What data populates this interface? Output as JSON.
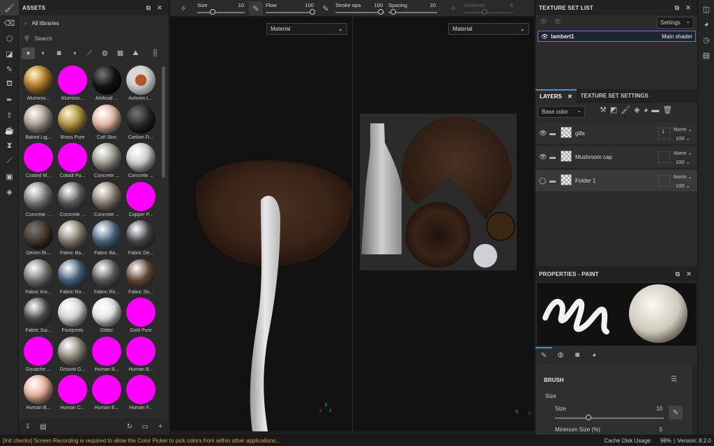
{
  "assets": {
    "title": "ASSETS",
    "all_libraries": "All libraries",
    "search_placeholder": "Search",
    "tiles": [
      {
        "label": "Aluminiu...",
        "color": "#b8862e",
        "style": "gold-dots"
      },
      {
        "label": "Aluminiu...",
        "color": "#ff00ff",
        "style": "flat"
      },
      {
        "label": "Artificial ...",
        "color": "#151515",
        "style": "dark"
      },
      {
        "label": "Autumn L...",
        "color": "#d8d8d8",
        "style": "leaf"
      },
      {
        "label": "Baked Lig...",
        "color": "#a8998a",
        "style": "flat"
      },
      {
        "label": "Brass Pure",
        "color": "#b89a4a",
        "style": "metal"
      },
      {
        "label": "Calf Skin",
        "color": "#e4b8a2",
        "style": "flat"
      },
      {
        "label": "Carbon Fi...",
        "color": "#2a2a2a",
        "style": "dark"
      },
      {
        "label": "Coated M...",
        "color": "#ff00ff",
        "style": "flat"
      },
      {
        "label": "Cobalt Pu...",
        "color": "#ff00ff",
        "style": "flat"
      },
      {
        "label": "Concrete ...",
        "color": "#9c9890",
        "style": "flat"
      },
      {
        "label": "Concrete ...",
        "color": "#cfcfcf",
        "style": "flat"
      },
      {
        "label": "Concrete ...",
        "color": "#7e7e7e",
        "style": "flat"
      },
      {
        "label": "Concrete ...",
        "color": "#5e5e5e",
        "style": "flat"
      },
      {
        "label": "Concrete ...",
        "color": "#8e8272",
        "style": "flat"
      },
      {
        "label": "Copper P...",
        "color": "#ff00ff",
        "style": "flat"
      },
      {
        "label": "Denim Ri...",
        "color": "#4a3a30",
        "style": "dark"
      },
      {
        "label": "Fabric Ba...",
        "color": "#8a8270",
        "style": "flat"
      },
      {
        "label": "Fabric Ba...",
        "color": "#4c6a82",
        "style": "flat"
      },
      {
        "label": "Fabric De...",
        "color": "#474a4e",
        "style": "flat"
      },
      {
        "label": "Fabric Kni...",
        "color": "#7a7a7a",
        "style": "flat"
      },
      {
        "label": "Fabric Ro...",
        "color": "#4a6480",
        "style": "flat"
      },
      {
        "label": "Fabric Ro...",
        "color": "#5e5e60",
        "style": "flat"
      },
      {
        "label": "Fabric So...",
        "color": "#6a4c3a",
        "style": "flat"
      },
      {
        "label": "Fabric Sui...",
        "color": "#4e4e4e",
        "style": "flat"
      },
      {
        "label": "Footprints",
        "color": "#d8d8d8",
        "style": "flat"
      },
      {
        "label": "Glitter",
        "color": "#e8e8e8",
        "style": "flat"
      },
      {
        "label": "Gold Pure",
        "color": "#ff00ff",
        "style": "flat"
      },
      {
        "label": "Gouache ...",
        "color": "#ff00ff",
        "style": "flat"
      },
      {
        "label": "Ground G...",
        "color": "#8e8a7a",
        "style": "flat"
      },
      {
        "label": "Human B...",
        "color": "#ff00ff",
        "style": "flat"
      },
      {
        "label": "Human B...",
        "color": "#ff00ff",
        "style": "flat"
      },
      {
        "label": "Human B...",
        "color": "#e8b098",
        "style": "flat"
      },
      {
        "label": "Human C...",
        "color": "#ff00ff",
        "style": "flat"
      },
      {
        "label": "Human E...",
        "color": "#ff00ff",
        "style": "flat"
      },
      {
        "label": "Human F...",
        "color": "#ff00ff",
        "style": "flat"
      }
    ]
  },
  "toolbar": {
    "size_label": "Size",
    "size_value": "10",
    "flow_label": "Flow",
    "flow_value": "100",
    "stroke_label": "Stroke opa",
    "stroke_value": "100",
    "spacing_label": "Spacing",
    "spacing_value": "20",
    "distance_label": "Distance",
    "distance_value": "8"
  },
  "viewport": {
    "left_select": "Material",
    "right_select": "Material"
  },
  "texture_set_list": {
    "title": "TEXTURE SET LIST",
    "settings": "Settings",
    "set_name": "lambert1",
    "shader": "Main shader"
  },
  "layers": {
    "tab_layers": "LAYERS",
    "tab_tss": "TEXTURE SET SETTINGS",
    "channel": "Base color",
    "rows": [
      {
        "name": "gills",
        "blend": "Norm",
        "opacity": "100",
        "badge": "1"
      },
      {
        "name": "Mushroom cap",
        "blend": "Norm",
        "opacity": "100",
        "badge": ""
      },
      {
        "name": "Folder 1",
        "blend": "Norm",
        "opacity": "100",
        "badge": ""
      }
    ]
  },
  "properties": {
    "title": "PROPERTIES - PAINT",
    "brush_title": "BRUSH",
    "size_section": "Size",
    "size_label": "Size",
    "size_value": "10",
    "min_size_label": "Minimum Size (%)",
    "min_size_value": "5"
  },
  "status": {
    "message": "[Init checks] Screen Recording is required to allow the Color Picker to pick colors from within other applications...",
    "cache": "Cache Disk Usage:",
    "cache_value": "98%",
    "version": "Version: 8.2.0"
  }
}
